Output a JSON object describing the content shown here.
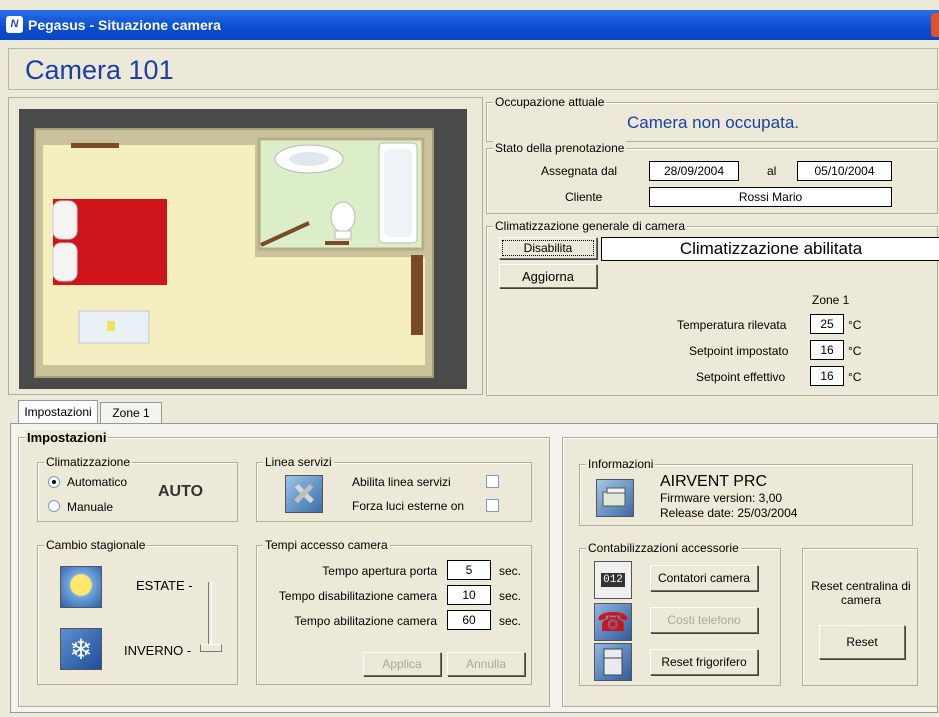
{
  "window": {
    "title": "Pegasus - Situazione camera",
    "icon_text": "N"
  },
  "header": {
    "room_title": "Camera 101"
  },
  "occupancy": {
    "legend": "Occupazione attuale",
    "status": "Camera non occupata."
  },
  "reservation": {
    "legend": "Stato della prenotazione",
    "assigned_label": "Assegnata dal",
    "from_date": "28/09/2004",
    "to_label": "al",
    "to_date": "05/10/2004",
    "client_label": "Cliente",
    "client_value": "Rossi Mario"
  },
  "climate_general": {
    "legend": "Climatizzazione generale di camera",
    "disable_button": "Disabilita",
    "refresh_button": "Aggiorna",
    "status": "Climatizzazione abilitata",
    "zone_header": "Zone 1",
    "rows": [
      {
        "label": "Temperatura rilevata",
        "value": "25",
        "unit": "°C"
      },
      {
        "label": "Setpoint impostato",
        "value": "16",
        "unit": "°C"
      },
      {
        "label": "Setpoint effettivo",
        "value": "16",
        "unit": "°C"
      }
    ]
  },
  "tabs": [
    {
      "label": "Impostazioni",
      "active": true
    },
    {
      "label": "Zone 1",
      "active": false
    }
  ],
  "settings": {
    "legend": "Impostazioni",
    "climate": {
      "legend": "Climatizzazione",
      "option_auto": "Automatico",
      "option_manual": "Manuale",
      "mode_display": "AUTO",
      "selected": "Automatico"
    },
    "service_line": {
      "legend": "Linea servizi",
      "enable_label": "Abilita linea servizi",
      "force_lights_label": "Forza luci esterne on"
    },
    "season": {
      "legend": "Cambio stagionale",
      "summer_label": "ESTATE -",
      "winter_label": "INVERNO -",
      "selected": "INVERNO"
    },
    "access_times": {
      "legend": "Tempi accesso camera",
      "rows": [
        {
          "label": "Tempo apertura porta",
          "value": "5",
          "unit": "sec."
        },
        {
          "label": "Tempo disabilitazione camera",
          "value": "10",
          "unit": "sec."
        },
        {
          "label": "Tempo abilitazione camera",
          "value": "60",
          "unit": "sec."
        }
      ],
      "apply_button": "Applica",
      "cancel_button": "Annulla"
    }
  },
  "info": {
    "legend": "Informazioni",
    "product": "AIRVENT PRC",
    "firmware": "Firmware version: 3,00",
    "release": "Release date: 25/03/2004"
  },
  "accessories": {
    "legend": "Contabilizzazioni accessorie",
    "counter_icon_text": "012",
    "room_counters_button": "Contatori camera",
    "phone_costs_button": "Costi telefono",
    "fridge_reset_button": "Reset frigorifero"
  },
  "reset_unit": {
    "label": "Reset centralina di camera",
    "button": "Reset"
  },
  "colors": {
    "title_blue": "#1a3fa8",
    "window_bg": "#ece9d8",
    "bed_red": "#d0141c",
    "floor": "#f5eebf"
  }
}
